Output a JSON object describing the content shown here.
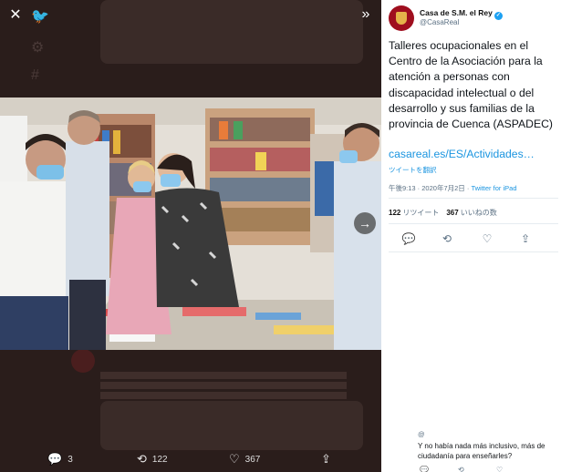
{
  "viewer": {
    "close_icon": "close-icon",
    "collapse_icon": "double-chevron-right-icon",
    "next_icon": "arrow-right-icon"
  },
  "action_bar": {
    "reply_count": "3",
    "retweet_count": "122",
    "like_count": "367"
  },
  "tweet": {
    "display_name": "Casa de S.M. el Rey",
    "handle": "@CasaReal",
    "text": "Talleres ocupacionales en el Centro de la Asociación para la atención a personas con discapacidad intelectual o del desarrollo y sus familias de la provincia de Cuenca (ASPADEC)",
    "link": "casareal.es/ES/Actividades…",
    "translate_label": "ツイートを翻訳",
    "time": "午後9:13 · 2020年7月2日 · ",
    "source": "Twitter for iPad",
    "retweets": "122",
    "retweets_label": "リツイート",
    "likes": "367",
    "likes_label": "いいねの数"
  },
  "reply": {
    "text": "Y no había nada más inclusivo, más de ciudadanía para enseñarles?"
  },
  "colors": {
    "accent": "#1da1f2",
    "link": "#1b95e0",
    "avatar_bg": "#9f0e1e"
  }
}
